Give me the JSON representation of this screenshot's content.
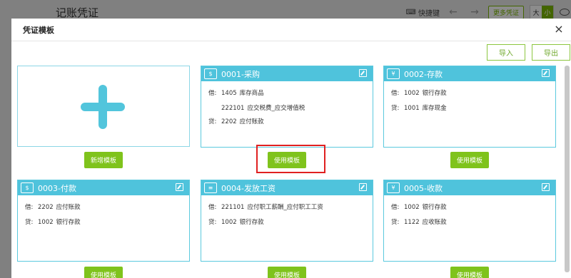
{
  "background": {
    "title": "记账凭证",
    "shortcut_label": "快捷键",
    "more_label": "更多凭证",
    "size_large": "大",
    "size_small": "小"
  },
  "modal": {
    "title": "凭证模板",
    "close": "×",
    "import_label": "导入",
    "export_label": "导出"
  },
  "add_template": {
    "button_label": "新增模板"
  },
  "use_button_label": "使用模板",
  "templates": [
    {
      "name": "0001-采购",
      "icon": "cash-register-icon",
      "entries": [
        {
          "dc": "借:",
          "code": "1405",
          "account": "库存商品"
        },
        {
          "dc": "",
          "code": "222101",
          "account": "应交税费_应交增值税"
        },
        {
          "dc": "贷:",
          "code": "2202",
          "account": "应付账款"
        }
      ]
    },
    {
      "name": "0002-存款",
      "icon": "deposit-icon",
      "entries": [
        {
          "dc": "借:",
          "code": "1002",
          "account": "银行存款"
        },
        {
          "dc": "贷:",
          "code": "1001",
          "account": "库存现金"
        }
      ]
    },
    {
      "name": "0003-付款",
      "icon": "payment-icon",
      "entries": [
        {
          "dc": "借:",
          "code": "2202",
          "account": "应付账款"
        },
        {
          "dc": "贷:",
          "code": "1002",
          "account": "银行存款"
        }
      ]
    },
    {
      "name": "0004-发放工资",
      "icon": "salary-icon",
      "entries": [
        {
          "dc": "借:",
          "code": "221101",
          "account": "应付职工薪酬_应付职工工资"
        },
        {
          "dc": "贷:",
          "code": "1002",
          "account": "银行存款"
        }
      ]
    },
    {
      "name": "0005-收款",
      "icon": "receipt-icon",
      "entries": [
        {
          "dc": "借:",
          "code": "1002",
          "account": "银行存款"
        },
        {
          "dc": "贷:",
          "code": "1122",
          "account": "应收账款"
        }
      ]
    }
  ],
  "colors": {
    "header": "#4fc3dc",
    "button": "#7fc31c",
    "highlight": "#e02020"
  }
}
